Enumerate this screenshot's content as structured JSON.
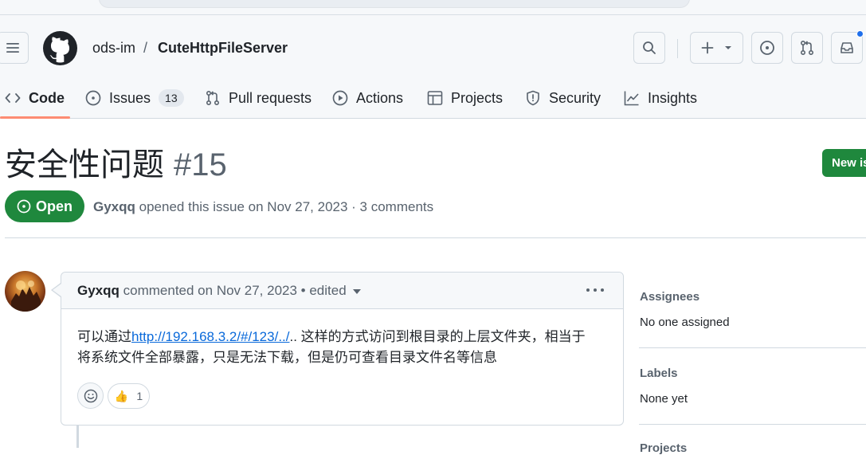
{
  "repo": {
    "owner": "ods-im",
    "separator": "/",
    "name": "CuteHttpFileServer"
  },
  "tabs": [
    {
      "label": "Code",
      "icon": "code-icon",
      "active": true
    },
    {
      "label": "Issues",
      "icon": "issue-opened-icon",
      "count": "13"
    },
    {
      "label": "Pull requests",
      "icon": "git-pull-request-icon"
    },
    {
      "label": "Actions",
      "icon": "play-icon"
    },
    {
      "label": "Projects",
      "icon": "table-icon"
    },
    {
      "label": "Security",
      "icon": "shield-icon"
    },
    {
      "label": "Insights",
      "icon": "graph-icon"
    }
  ],
  "header_icons": [
    "hamburger-icon",
    "github-logo-icon",
    "search-icon",
    "plus-icon",
    "issue-opened-icon",
    "git-pull-request-icon",
    "inbox-icon"
  ],
  "issue": {
    "title": "安全性问题",
    "number": "#15",
    "state": "Open",
    "author": "Gyxqq",
    "opened_text": "opened this issue on Nov 27, 2023 · 3 comments",
    "new_issue_label": "New is"
  },
  "comment": {
    "author": "Gyxqq",
    "meta_text": "commented on Nov 27, 2023 • edited",
    "body_prefix": "可以通过",
    "body_link": "http://192.168.3.2/#/123/../",
    "body_line1_rest": ".. 这样的方式访问到根目录的上层文件夹，相当于",
    "body_line2": "将系统文件全部暴露，只是无法下载，但是仍可查看目录文件名等信息",
    "reactions": [
      {
        "emoji": "👍",
        "count": "1"
      }
    ]
  },
  "sidebar": {
    "assignees_title": "Assignees",
    "assignees_value": "No one assigned",
    "labels_title": "Labels",
    "labels_value": "None yet",
    "projects_title": "Projects"
  },
  "colors": {
    "open_green": "#1f883d",
    "link_blue": "#0969da",
    "tab_underline": "#fd8c73",
    "notification_dot": "#1f6feb"
  }
}
